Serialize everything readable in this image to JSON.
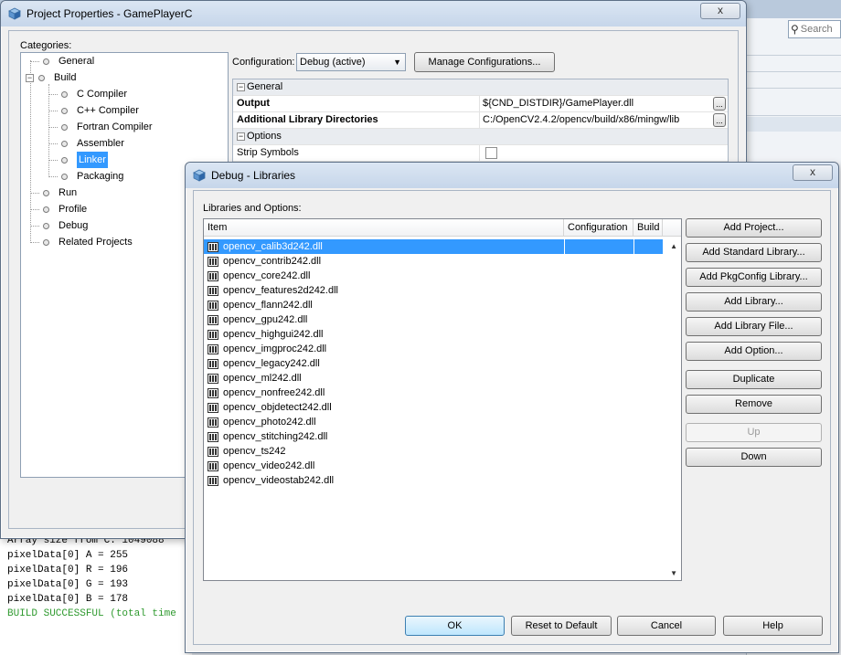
{
  "background": {
    "search_placeholder": "Search",
    "output_lines": [
      "Array size from C: 1049088",
      "pixelData[0] A = 255",
      "pixelData[0] R = 196",
      "pixelData[0] G = 193",
      "pixelData[0] B = 178",
      "BUILD SUCCESSFUL (total time"
    ]
  },
  "properties": {
    "title": "Project Properties - GamePlayerC",
    "close_glyph": "x",
    "categories_label": "Categories:",
    "tree": [
      {
        "label": "General"
      },
      {
        "label": "Build"
      },
      {
        "label": "C Compiler"
      },
      {
        "label": "C++ Compiler"
      },
      {
        "label": "Fortran Compiler"
      },
      {
        "label": "Assembler"
      },
      {
        "label": "Linker"
      },
      {
        "label": "Packaging"
      },
      {
        "label": "Run"
      },
      {
        "label": "Profile"
      },
      {
        "label": "Debug"
      },
      {
        "label": "Related Projects"
      }
    ],
    "tree_expander": "−",
    "configuration_label": "Configuration:",
    "configuration_value": "Debug (active)",
    "manage_configurations": "Manage Configurations...",
    "sheet": {
      "general_section": "General",
      "output_label": "Output",
      "output_value": "${CND_DISTDIR}/GamePlayer.dll",
      "additional_lib_dirs_label": "Additional Library Directories",
      "additional_lib_dirs_value": "C:/OpenCV2.4.2/opencv/build/x86/mingw/lib",
      "options_section": "Options",
      "strip_symbols_label": "Strip Symbols",
      "section_sign": "−",
      "browse_glyph": "..."
    }
  },
  "libraries": {
    "title": "Debug - Libraries",
    "close_glyph": "x",
    "list_label": "Libraries and Options:",
    "columns": {
      "item": "Item",
      "configuration": "Configuration",
      "build": "Build"
    },
    "items": [
      "opencv_calib3d242.dll",
      "opencv_contrib242.dll",
      "opencv_core242.dll",
      "opencv_features2d242.dll",
      "opencv_flann242.dll",
      "opencv_gpu242.dll",
      "opencv_highgui242.dll",
      "opencv_imgproc242.dll",
      "opencv_legacy242.dll",
      "opencv_ml242.dll",
      "opencv_nonfree242.dll",
      "opencv_objdetect242.dll",
      "opencv_photo242.dll",
      "opencv_stitching242.dll",
      "opencv_ts242",
      "opencv_video242.dll",
      "opencv_videostab242.dll"
    ],
    "buttons": {
      "add_project": "Add Project...",
      "add_standard_library": "Add Standard Library...",
      "add_pkgconfig_library": "Add PkgConfig Library...",
      "add_library": "Add Library...",
      "add_library_file": "Add Library File...",
      "add_option": "Add Option...",
      "duplicate": "Duplicate",
      "remove": "Remove",
      "up": "Up",
      "down": "Down"
    },
    "footer": {
      "ok": "OK",
      "reset": "Reset to Default",
      "cancel": "Cancel",
      "help": "Help"
    }
  },
  "colors": {
    "selection": "#3399ff",
    "titlebar": "#c6d6ea",
    "build_success": "#2f9a2f"
  }
}
